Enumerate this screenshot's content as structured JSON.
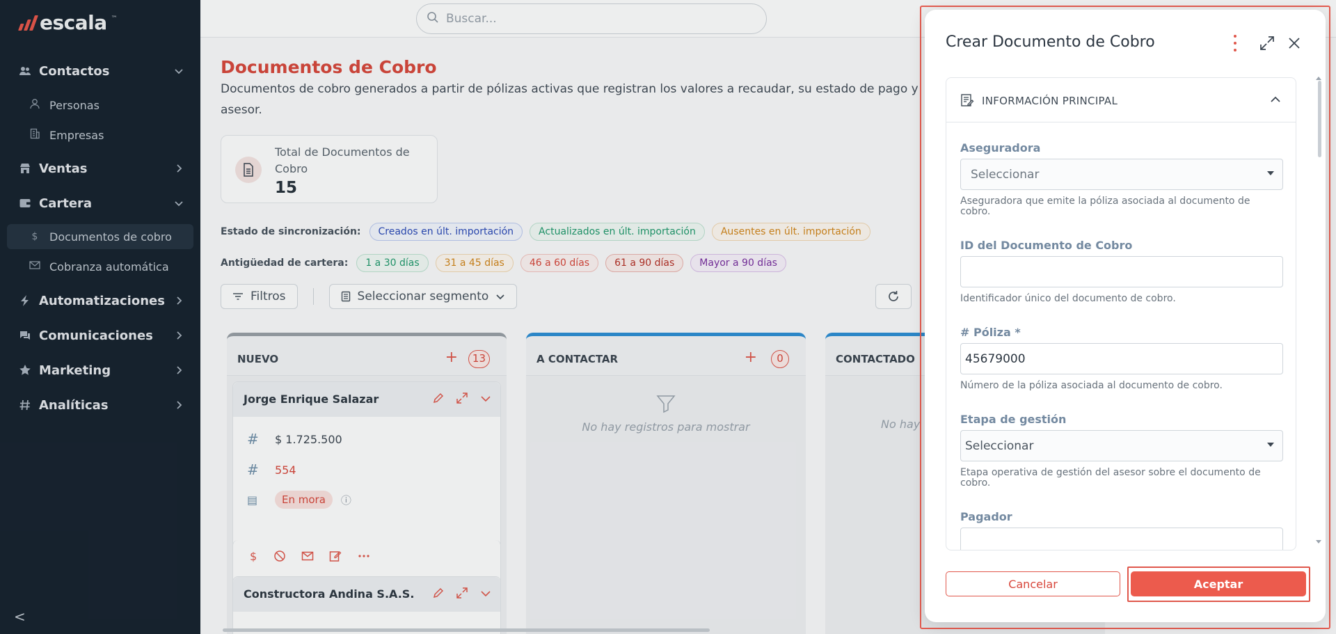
{
  "brand": {
    "name": "escala",
    "tm": "™",
    "accent": "#e9564a"
  },
  "sidebar": {
    "items": [
      {
        "label": "Contactos",
        "icon": "users-icon"
      },
      {
        "label": "Personas",
        "icon": "user-icon"
      },
      {
        "label": "Empresas",
        "icon": "building-icon"
      },
      {
        "label": "Ventas",
        "icon": "store-icon"
      },
      {
        "label": "Cartera",
        "icon": "wallet-icon"
      },
      {
        "label": "Documentos de cobro",
        "icon": "dollar-icon"
      },
      {
        "label": "Cobranza automática",
        "icon": "mail-icon"
      },
      {
        "label": "Automatizaciones",
        "icon": "bolt-icon"
      },
      {
        "label": "Comunicaciones",
        "icon": "chat-icon"
      },
      {
        "label": "Marketing",
        "icon": "star-icon"
      },
      {
        "label": "Analíticas",
        "icon": "hash-icon"
      }
    ],
    "collapse_glyph": "<"
  },
  "search": {
    "placeholder": "Buscar..."
  },
  "page": {
    "title": "Documentos de Cobro",
    "description": "Documentos de cobro generados a partir de pólizas activas que registran los valores a recaudar, su estado de pago y asesor."
  },
  "stat": {
    "label": "Total de Documentos de Cobro",
    "value": "15"
  },
  "sync": {
    "label": "Estado de sincronización:",
    "chips": [
      {
        "label": "Creados en últ. importación",
        "color": "#2a49b8"
      },
      {
        "label": "Actualizados en últ. importación",
        "color": "#1f9a6c"
      },
      {
        "label": "Ausentes en últ. importación",
        "color": "#d3861a"
      }
    ]
  },
  "aging": {
    "label": "Antigüedad de cartera:",
    "chips": [
      {
        "label": "1 a 30 días",
        "color": "#1f9a6c"
      },
      {
        "label": "31 a 45 días",
        "color": "#d3861a"
      },
      {
        "label": "46 a 60 días",
        "color": "#d8473b"
      },
      {
        "label": "61 a 90 días",
        "color": "#b73025"
      },
      {
        "label": "Mayor a 90 días",
        "color": "#7a2fa0"
      }
    ]
  },
  "toolbar": {
    "filters": "Filtros",
    "segment": "Seleccionar segmento"
  },
  "kanban": {
    "columns": [
      {
        "title": "NUEVO",
        "count": "13",
        "color": "#9aa0a6"
      },
      {
        "title": "A CONTACTAR",
        "count": "0",
        "color": "#2d8fd5",
        "empty": "No hay registros para mostrar"
      },
      {
        "title": "CONTACTADO",
        "color": "#2d8fd5",
        "empty": "No hay"
      }
    ],
    "cards": [
      {
        "name": "Jorge Enrique Salazar",
        "amount": "$ 1.725.500",
        "number": "554",
        "status": "En mora",
        "hash_glyph": "#",
        "status_glyph": "▤",
        "info_glyph": "ⓘ"
      },
      {
        "name": "Constructora Andina S.A.S."
      }
    ]
  },
  "modal": {
    "title": "Crear Documento de Cobro",
    "section": "INFORMACIÓN PRINCIPAL",
    "fields": [
      {
        "label": "Aseguradora",
        "placeholder": "Seleccionar",
        "help": "Aseguradora que emite la póliza asociada al documento de cobro."
      },
      {
        "label": "ID del Documento de Cobro",
        "value": "",
        "help": "Identificador único del documento de cobro."
      },
      {
        "label": "# Póliza *",
        "value": "45679000",
        "help": "Número de la póliza asociada al documento de cobro."
      },
      {
        "label": "Etapa de gestión",
        "placeholder": "Seleccionar",
        "help": "Etapa operativa de gestión del asesor sobre el documento de cobro."
      },
      {
        "label": "Pagador",
        "value": ""
      }
    ],
    "cancel": "Cancelar",
    "accept": "Aceptar"
  }
}
